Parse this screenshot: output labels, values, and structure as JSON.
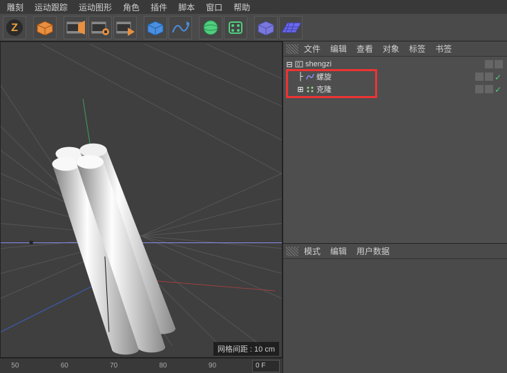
{
  "menu": {
    "items": [
      "雕刻",
      "运动跟踪",
      "运动图形",
      "角色",
      "插件",
      "脚本",
      "窗口",
      "帮助"
    ]
  },
  "toolbar": {
    "buttons": [
      "file-z",
      "cube-icon",
      "film-edit-icon",
      "film-record-icon",
      "film-play-icon",
      "render-cube",
      "render-curve",
      "sphere-green",
      "mesh-green",
      "cube-blue",
      "grid-floor"
    ]
  },
  "viewport": {
    "grid_status": "网格间距 : 10 cm"
  },
  "timeline": {
    "ticks": [
      "50",
      "",
      "60",
      "",
      "70",
      "",
      "80",
      "",
      "90",
      ""
    ],
    "current": "0 F"
  },
  "obj_tabs": {
    "items": [
      "文件",
      "编辑",
      "查看",
      "对象",
      "标签",
      "书签"
    ]
  },
  "objects": {
    "root": {
      "label": "shengzi",
      "icon": "null-icon"
    },
    "children": [
      {
        "label": "螺旋",
        "icon": "helix-icon",
        "color": "#8a8af0"
      },
      {
        "label": "克隆",
        "icon": "cloner-icon",
        "color": "#9fd090"
      }
    ]
  },
  "attr_tabs": {
    "items": [
      "模式",
      "编辑",
      "用户数据"
    ]
  },
  "checkmark": "✓",
  "colors": {
    "highlight": "#e33",
    "green": "#4fcf7f"
  }
}
